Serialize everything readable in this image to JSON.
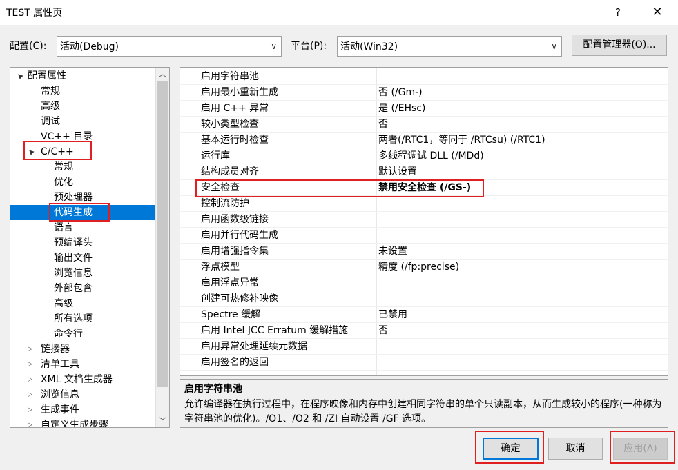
{
  "window": {
    "title": "TEST 属性页",
    "help_label": "?",
    "close_label": "✕"
  },
  "config": {
    "config_label": "配置(C):",
    "config_value": "活动(Debug)",
    "platform_label": "平台(P):",
    "platform_value": "活动(Win32)",
    "manager_button": "配置管理器(O)..."
  },
  "tree": {
    "items": [
      {
        "label": "配置属性",
        "expander": "▲"
      },
      {
        "label": "常规",
        "expander": ""
      },
      {
        "label": "高级",
        "expander": ""
      },
      {
        "label": "调试",
        "expander": ""
      },
      {
        "label": "VC++ 目录",
        "expander": ""
      },
      {
        "label": "C/C++",
        "expander": "▲"
      },
      {
        "label": "常规",
        "expander": ""
      },
      {
        "label": "优化",
        "expander": ""
      },
      {
        "label": "预处理器",
        "expander": ""
      },
      {
        "label": "代码生成",
        "expander": ""
      },
      {
        "label": "语言",
        "expander": ""
      },
      {
        "label": "预编译头",
        "expander": ""
      },
      {
        "label": "输出文件",
        "expander": ""
      },
      {
        "label": "浏览信息",
        "expander": ""
      },
      {
        "label": "外部包含",
        "expander": ""
      },
      {
        "label": "高级",
        "expander": ""
      },
      {
        "label": "所有选项",
        "expander": ""
      },
      {
        "label": "命令行",
        "expander": ""
      },
      {
        "label": "链接器",
        "expander": "▷"
      },
      {
        "label": "清单工具",
        "expander": "▷"
      },
      {
        "label": "XML 文档生成器",
        "expander": "▷"
      },
      {
        "label": "浏览信息",
        "expander": "▷"
      },
      {
        "label": "生成事件",
        "expander": "▷"
      },
      {
        "label": "自定义生成步骤",
        "expander": "▷"
      }
    ],
    "scroll_up": "︿",
    "scroll_down": "﹀"
  },
  "properties": [
    {
      "name": "启用字符串池",
      "value": ""
    },
    {
      "name": "启用最小重新生成",
      "value": "否 (/Gm-)"
    },
    {
      "name": "启用 C++ 异常",
      "value": "是 (/EHsc)"
    },
    {
      "name": "较小类型检查",
      "value": "否"
    },
    {
      "name": "基本运行时检查",
      "value": "两者(/RTC1，等同于 /RTCsu) (/RTC1)"
    },
    {
      "name": "运行库",
      "value": "多线程调试 DLL (/MDd)"
    },
    {
      "name": "结构成员对齐",
      "value": "默认设置"
    },
    {
      "name": "安全检查",
      "value": "禁用安全检查 (/GS-)"
    },
    {
      "name": "控制流防护",
      "value": ""
    },
    {
      "name": "启用函数级链接",
      "value": ""
    },
    {
      "name": "启用并行代码生成",
      "value": ""
    },
    {
      "name": "启用增强指令集",
      "value": "未设置"
    },
    {
      "name": "浮点模型",
      "value": "精度 (/fp:precise)"
    },
    {
      "name": "启用浮点异常",
      "value": ""
    },
    {
      "name": "创建可热修补映像",
      "value": ""
    },
    {
      "name": "Spectre 缓解",
      "value": "已禁用"
    },
    {
      "name": "启用 Intel JCC Erratum 缓解措施",
      "value": "否"
    },
    {
      "name": "启用异常处理延续元数据",
      "value": ""
    },
    {
      "name": "启用签名的返回",
      "value": ""
    }
  ],
  "description": {
    "title": "启用字符串池",
    "text": "允许编译器在执行过程中，在程序映像和内存中创建相同字符串的单个只读副本，从而生成较小的程序(一种称为字符串池的优化)。/O1、/O2 和 /ZI 自动设置 /GF 选项。"
  },
  "buttons": {
    "ok": "确定",
    "cancel": "取消",
    "apply": "应用(A)"
  },
  "colors": {
    "selection": "#0078d7",
    "highlight_box": "#e02020"
  }
}
